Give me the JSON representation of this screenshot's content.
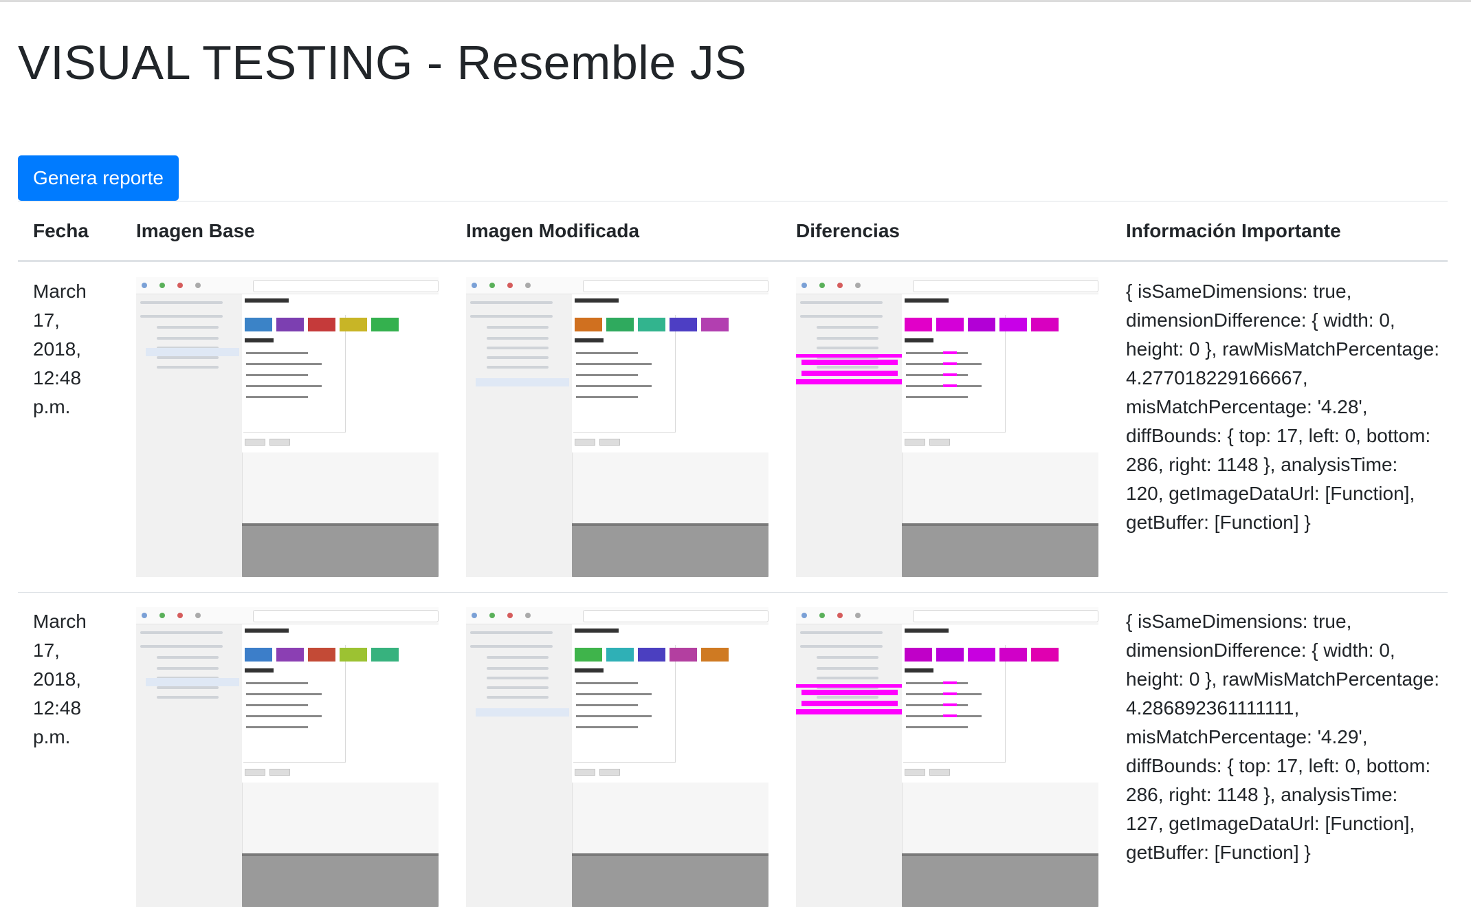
{
  "title": "VISUAL TESTING - Resemble JS",
  "button": {
    "label": "Genera reporte"
  },
  "table": {
    "headers": [
      "Fecha",
      "Imagen Base",
      "Imagen Modificada",
      "Diferencias",
      "Información Importante"
    ],
    "rows": [
      {
        "date": "March 17, 2018, 12:48 p.m.",
        "info": "{ isSameDimensions: true, dimensionDifference: { width: 0, height: 0 }, rawMisMatchPercentage: 4.277018229166667, misMatchPercentage: '4.28', diffBounds: { top: 17, left: 0, bottom: 286, right: 1148 }, analysisTime: 120, getImageDataUrl: [Function], getBuffer: [Function] }",
        "base_swatches": [
          "#3b83c7",
          "#7c3fb1",
          "#c53a3a",
          "#c8b526",
          "#34b14e"
        ],
        "mod_swatches": [
          "#d0701f",
          "#2faa5e",
          "#32b48e",
          "#4d3ec4",
          "#b23fb0"
        ],
        "diff_swatches": [
          "#e100c8",
          "#d400d8",
          "#b200d6",
          "#c800e8",
          "#d800c0"
        ]
      },
      {
        "date": "March 17, 2018, 12:48 p.m.",
        "info": "{ isSameDimensions: true, dimensionDifference: { width: 0, height: 0 }, rawMisMatchPercentage: 4.286892361111111, misMatchPercentage: '4.29', diffBounds: { top: 17, left: 0, bottom: 286, right: 1148 }, analysisTime: 127, getImageDataUrl: [Function], getBuffer: [Function] }",
        "base_swatches": [
          "#3c7ec9",
          "#8b3fb3",
          "#c34a36",
          "#9cc232",
          "#37b27e"
        ],
        "mod_swatches": [
          "#3fb44b",
          "#2fb0b6",
          "#4b3fc0",
          "#b33fa0",
          "#cf7a22"
        ],
        "diff_swatches": [
          "#c000c8",
          "#b800d8",
          "#c800e0",
          "#d000c8",
          "#e000b0"
        ]
      }
    ]
  }
}
